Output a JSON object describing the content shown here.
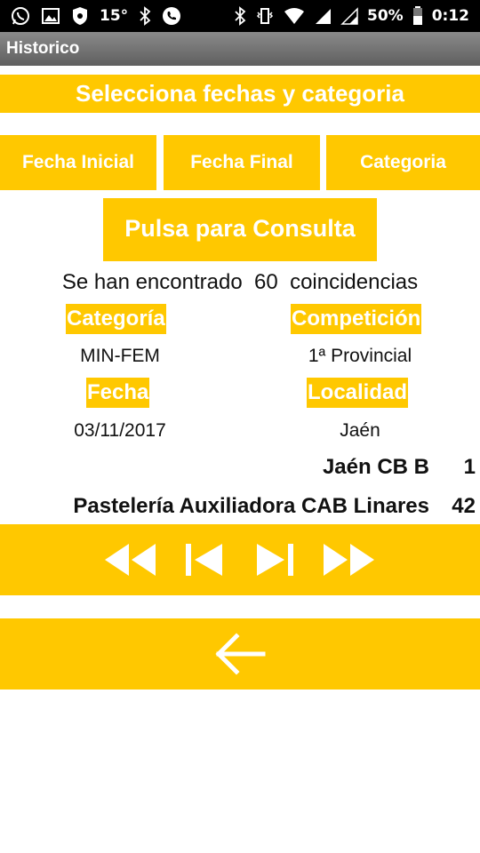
{
  "status": {
    "temperature": "15°",
    "battery": "50%",
    "time": "0:12"
  },
  "app": {
    "title": "Historico"
  },
  "main": {
    "header": "Selecciona fechas y categoria",
    "buttons": {
      "fecha_inicial": "Fecha Inicial",
      "fecha_final": "Fecha Final",
      "categoria": "Categoria",
      "consulta": "Pulsa para Consulta"
    },
    "found": {
      "prefix": "Se han encontrado",
      "count": "60",
      "suffix": "coincidencias"
    },
    "fields": {
      "categoria_label": "Categoría",
      "categoria_value": "MIN-FEM",
      "competicion_label": "Competición",
      "competicion_value": "1ª Provincial",
      "fecha_label": "Fecha",
      "fecha_value": "03/11/2017",
      "localidad_label": "Localidad",
      "localidad_value": "Jaén"
    },
    "match": {
      "home_team": "Jaén CB B",
      "home_score": "1",
      "away_team": "Pastelería Auxiliadora CAB Linares",
      "away_score": "42"
    }
  },
  "icons": {
    "nav": [
      "rewind-icon",
      "skip-previous-icon",
      "skip-next-icon",
      "fast-forward-icon"
    ],
    "back": "arrow-left-icon"
  },
  "colors": {
    "accent": "#ffc800",
    "actionbar": "#707070"
  }
}
